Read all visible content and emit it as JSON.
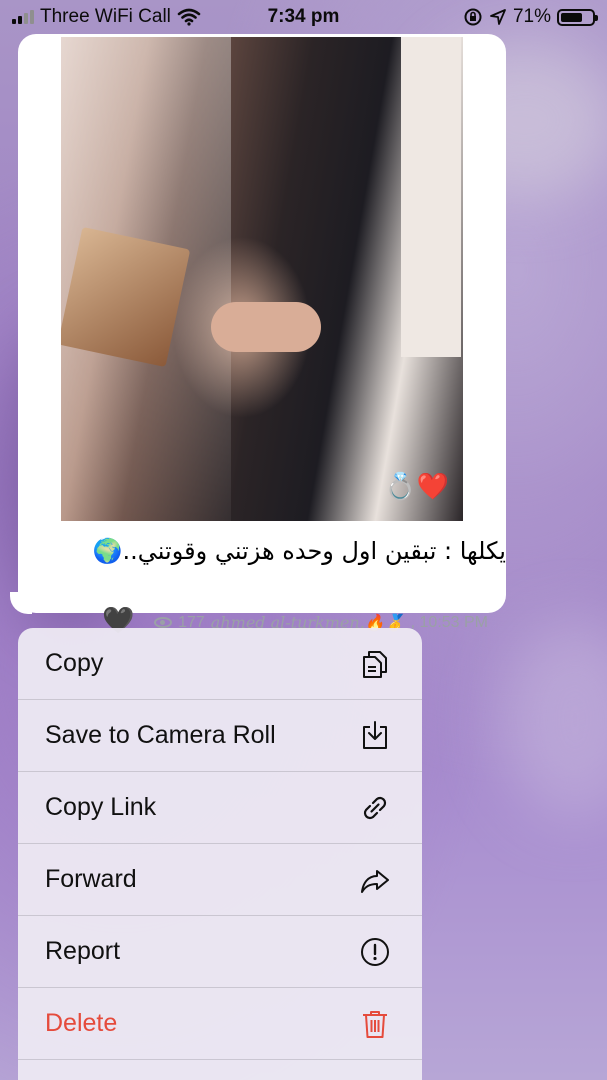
{
  "status_bar": {
    "carrier": "Three WiFi Call",
    "time": "7:34 pm",
    "battery_percent": "71%",
    "battery_level": 0.71
  },
  "message": {
    "caption": "يكلها : تبقين اول وحده هزتني وقوتني..🌍",
    "trailing_emoji": "🖤",
    "photo_badge": "💍❤️",
    "views": "177",
    "author": "ahmed al-turkmen.🔥🥇",
    "timestamp": ", 10:53 PM"
  },
  "context_menu": {
    "items": [
      {
        "label": "Copy",
        "icon": "copy-icon",
        "danger": false
      },
      {
        "label": "Save to Camera Roll",
        "icon": "download-icon",
        "danger": false
      },
      {
        "label": "Copy Link",
        "icon": "link-icon",
        "danger": false
      },
      {
        "label": "Forward",
        "icon": "forward-icon",
        "danger": false
      },
      {
        "label": "Report",
        "icon": "report-icon",
        "danger": false
      },
      {
        "label": "Delete",
        "icon": "trash-icon",
        "danger": true
      }
    ]
  },
  "colors": {
    "danger": "#e54b3c",
    "menu_background": "#ece8f2",
    "meta_gray": "#9aa0a6"
  }
}
